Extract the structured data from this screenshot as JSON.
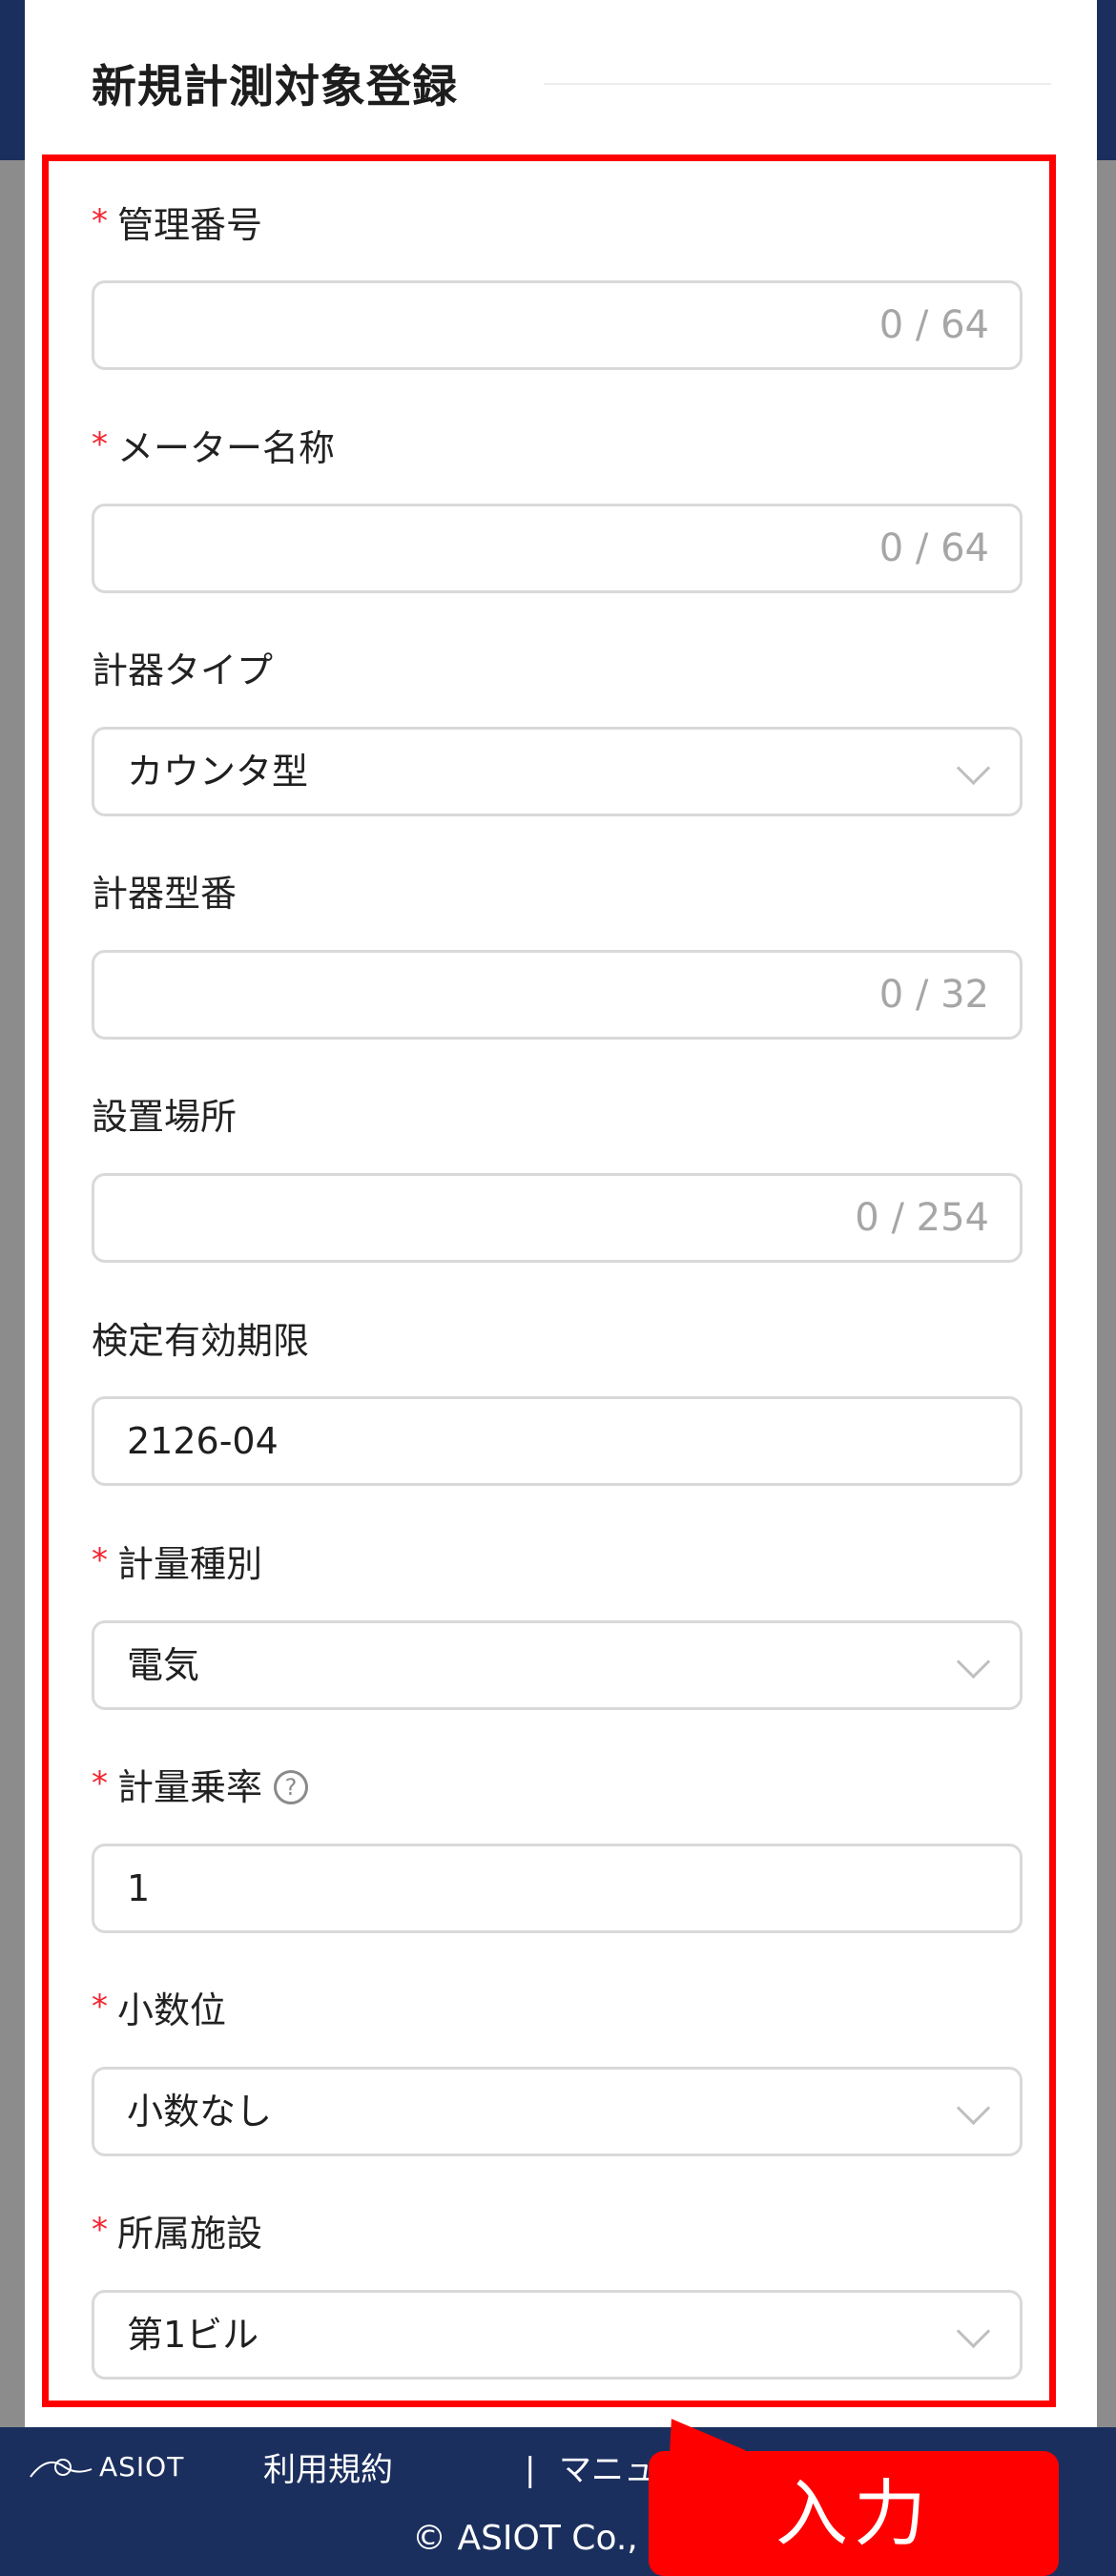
{
  "modal": {
    "title": "新規計測対象登録"
  },
  "fields": {
    "management_number": {
      "label": "管理番号",
      "required_mark": "*",
      "counter": "0 / 64"
    },
    "meter_name": {
      "label": "メーター名称",
      "required_mark": "*",
      "counter": "0 / 64"
    },
    "instrument_type": {
      "label": "計器タイプ",
      "value": "カウンタ型"
    },
    "instrument_model": {
      "label": "計器型番",
      "counter": "0 / 32"
    },
    "installation_location": {
      "label": "設置場所",
      "counter": "0 / 254"
    },
    "verification_expiry": {
      "label": "検定有効期限",
      "value": "2126-04"
    },
    "measurement_type": {
      "label": "計量種別",
      "required_mark": "*",
      "value": "電気"
    },
    "measurement_multiplier": {
      "label": "計量乗率",
      "required_mark": "*",
      "help_icon": "?",
      "value": "1"
    },
    "decimal_places": {
      "label": "小数位",
      "required_mark": "*",
      "value": "小数なし"
    },
    "facility": {
      "label": "所属施設",
      "required_mark": "*",
      "value": "第1ビル"
    }
  },
  "footer": {
    "logo_text": "ASIOT",
    "terms_link": "利用規約",
    "separator": "|",
    "manual_link": "マニュ",
    "copyright": "© ASIOT Co., L"
  },
  "callout": {
    "text": "入力"
  },
  "icons": {
    "select_arrow": "chevron-down-icon",
    "help": "question-circle-icon",
    "logo": "asiot-logo-icon"
  },
  "colors": {
    "header_navy": "#1b2f5e",
    "highlight_red": "#ff0000",
    "required_red": "#f5222d",
    "overlay_gray": "#8c8c8c"
  }
}
